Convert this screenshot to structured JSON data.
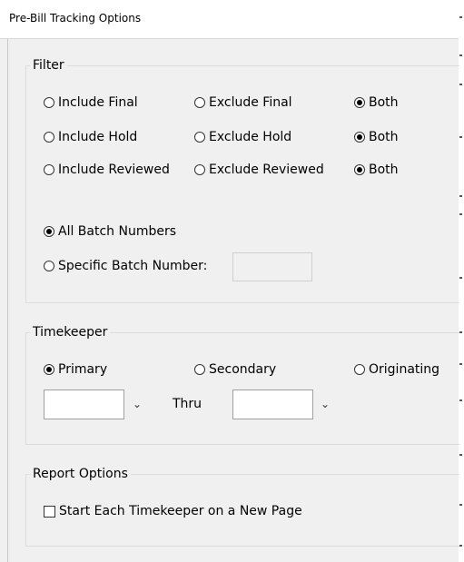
{
  "window": {
    "title": "Pre-Bill Tracking Options"
  },
  "filter": {
    "legend": "Filter",
    "rows": [
      {
        "include": "Include Final",
        "exclude": "Exclude Final",
        "both": "Both",
        "selected": "both"
      },
      {
        "include": "Include Hold",
        "exclude": "Exclude Hold",
        "both": "Both",
        "selected": "both"
      },
      {
        "include": "Include Reviewed",
        "exclude": "Exclude Reviewed",
        "both": "Both",
        "selected": "both"
      }
    ],
    "all_batch_label": "All Batch Numbers",
    "specific_batch_label": "Specific Batch Number:",
    "batch_selected": "all",
    "specific_batch_value": ""
  },
  "timekeeper": {
    "legend": "Timekeeper",
    "primary": "Primary",
    "secondary": "Secondary",
    "originating": "Originating",
    "selected": "primary",
    "thru_label": "Thru",
    "from_value": "",
    "to_value": ""
  },
  "report_options": {
    "legend": "Report Options",
    "new_page_label": "Start Each Timekeeper on a New Page",
    "new_page_checked": false
  }
}
